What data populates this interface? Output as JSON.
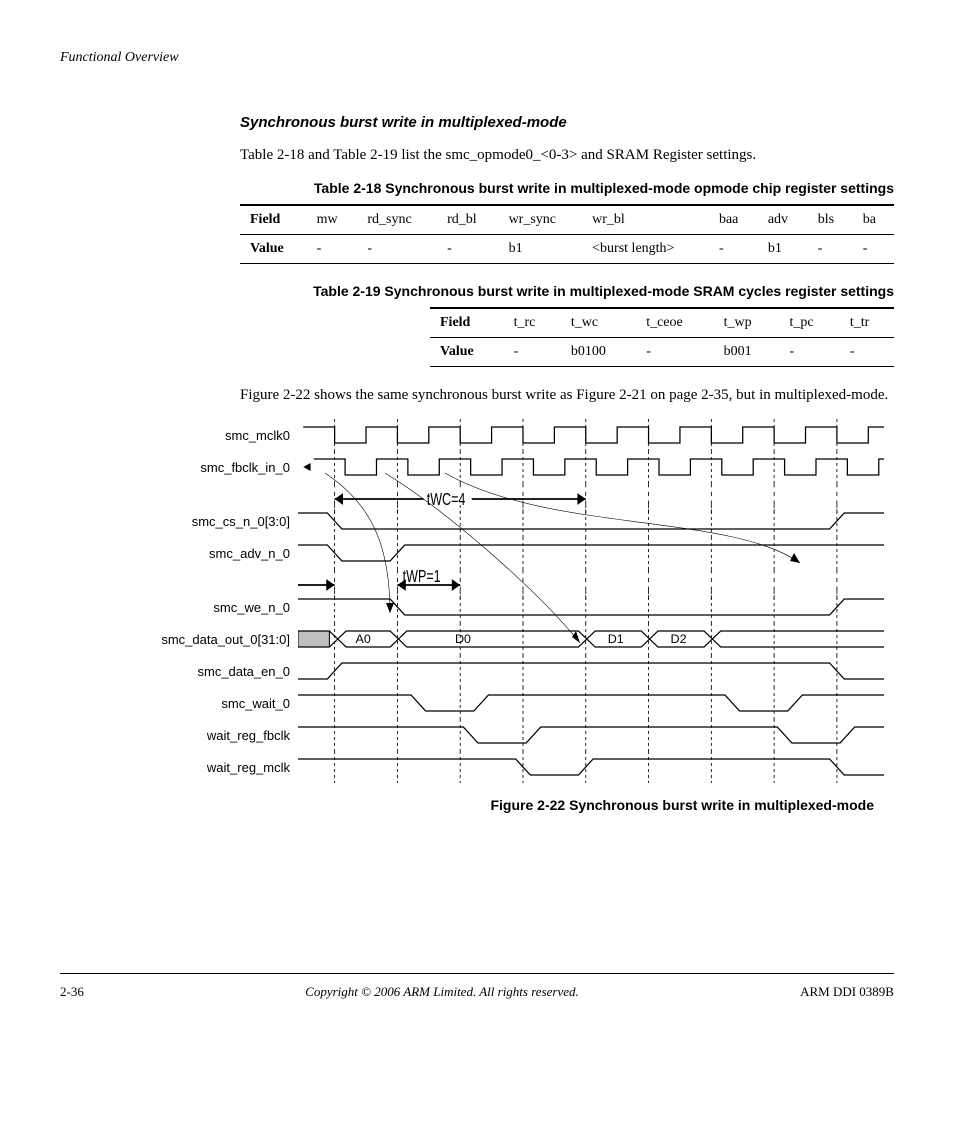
{
  "running_head": "Functional Overview",
  "subheading": "Synchronous burst write in multiplexed-mode",
  "para_intro": "Table 2-18 and Table 2-19 list the smc_opmode0_<0-3> and SRAM Register settings.",
  "table18": {
    "caption": "Table 2-18 Synchronous burst write in multiplexed-mode opmode chip register settings",
    "headers": [
      "Field",
      "mw",
      "rd_sync",
      "rd_bl",
      "wr_sync",
      "wr_bl",
      "baa",
      "adv",
      "bls",
      "ba"
    ],
    "row_label": "Value",
    "row": [
      "-",
      "-",
      "-",
      "b1",
      "<burst length>",
      "-",
      "b1",
      "-",
      "-"
    ]
  },
  "table19": {
    "caption": "Table 2-19 Synchronous burst write in multiplexed-mode SRAM cycles register settings",
    "headers": [
      "Field",
      "t_rc",
      "t_wc",
      "t_ceoe",
      "t_wp",
      "t_pc",
      "t_tr"
    ],
    "row_label": "Value",
    "row": [
      "-",
      "b0100",
      "-",
      "b001",
      "-",
      "-"
    ]
  },
  "para_fig": "Figure 2-22 shows the same synchronous burst write as Figure 2-21 on page 2-35, but in multiplexed-mode.",
  "diagram": {
    "signals": [
      "smc_mclk0",
      "smc_fbclk_in_0",
      "smc_cs_n_0[3:0]",
      "smc_adv_n_0",
      "smc_we_n_0",
      "smc_data_out_0[31:0]",
      "smc_data_en_0",
      "smc_wait_0",
      "wait_reg_fbclk",
      "wait_reg_mclk"
    ],
    "twc_label": "tWC=4",
    "twp_label": "tWP=1",
    "data_labels": [
      "A0",
      "D0",
      "D1",
      "D2"
    ]
  },
  "figure_caption": "Figure 2-22 Synchronous burst write in multiplexed-mode",
  "footer": {
    "page": "2-36",
    "copyright": "Copyright © 2006 ARM Limited. All rights reserved.",
    "docid": "ARM DDI 0389B"
  }
}
